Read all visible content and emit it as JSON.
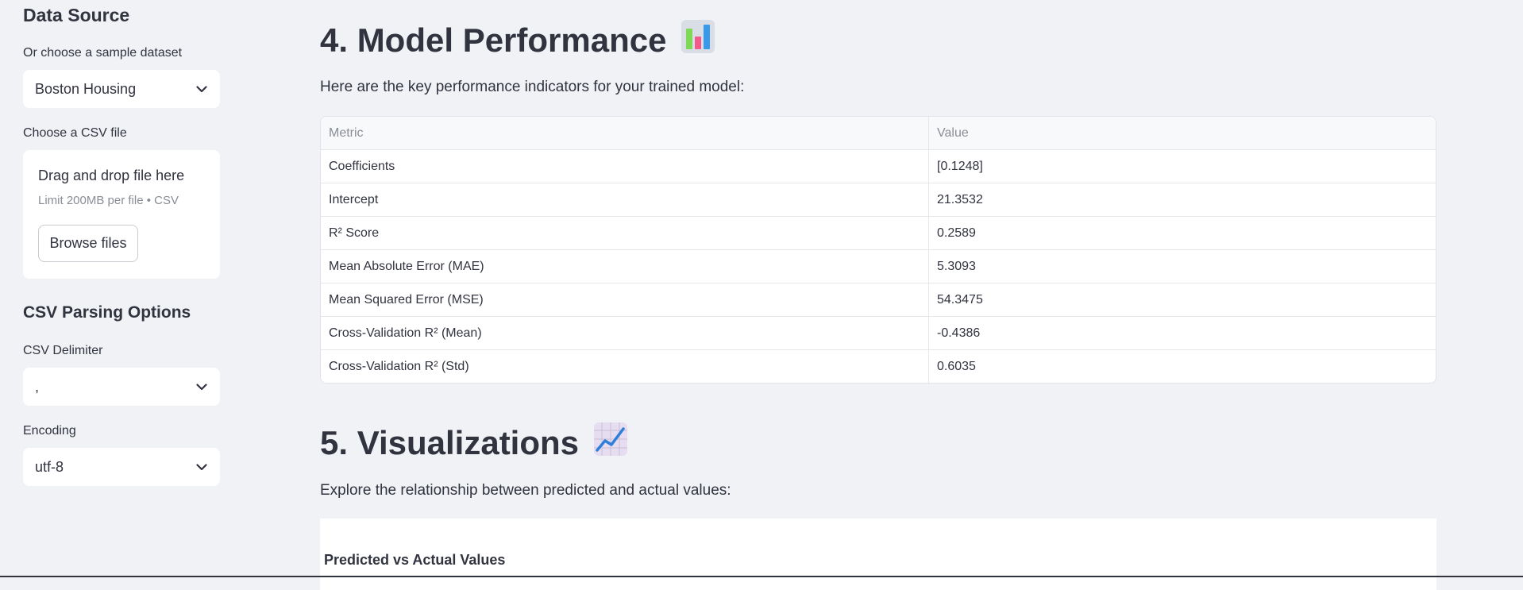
{
  "sidebar": {
    "data_source_heading": "Data Source",
    "sample_label": "Or choose a sample dataset",
    "sample_value": "Boston Housing",
    "csv_label": "Choose a CSV file",
    "uploader": {
      "title": "Drag and drop file here",
      "limit": "Limit 200MB per file • CSV",
      "browse_label": "Browse files"
    },
    "parsing_heading": "CSV Parsing Options",
    "delimiter_label": "CSV Delimiter",
    "delimiter_value": ",",
    "encoding_label": "Encoding",
    "encoding_value": "utf-8"
  },
  "main": {
    "section4_title": "4. Model Performance",
    "section4_intro": "Here are the key performance indicators for your trained model:",
    "table": {
      "headers": [
        "Metric",
        "Value"
      ],
      "rows": [
        [
          "Coefficients",
          "[0.1248]"
        ],
        [
          "Intercept",
          "21.3532"
        ],
        [
          "R² Score",
          "0.2589"
        ],
        [
          "Mean Absolute Error (MAE)",
          "5.3093"
        ],
        [
          "Mean Squared Error (MSE)",
          "54.3475"
        ],
        [
          "Cross-Validation R² (Mean)",
          "-0.4386"
        ],
        [
          "Cross-Validation R² (Std)",
          "0.6035"
        ]
      ]
    },
    "section5_title": "5. Visualizations",
    "section5_intro": "Explore the relationship between predicted and actual values:",
    "chart_title": "Predicted vs Actual Values"
  },
  "icons": {
    "bar_chart": "bar-chart-emoji-icon",
    "line_chart": "line-chart-emoji-icon",
    "chevron": "chevron-down-icon"
  }
}
